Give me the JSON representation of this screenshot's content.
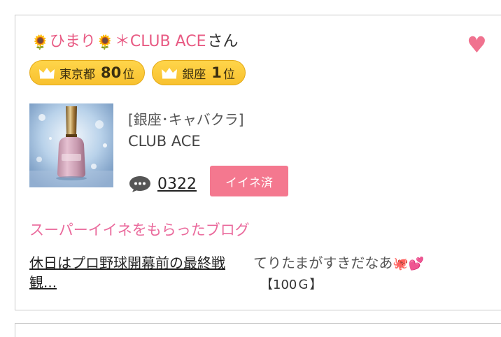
{
  "entry": {
    "name_icon_left": "🌻",
    "name_mid": "ひまり",
    "name_icon_mid": "🌻",
    "name_tail": "＊CLUB ACE",
    "honorific": "さん",
    "favorite_icon": "heart-icon",
    "badges": [
      {
        "area": "東京都",
        "rank": "80",
        "suffix": "位"
      },
      {
        "area": "銀座",
        "rank": "1",
        "suffix": "位"
      }
    ],
    "category": "[銀座･キャバクラ]",
    "shop": "CLUB ACE",
    "comment_count": "0322",
    "iine_label": "イイネ済"
  },
  "section_title": "スーパーイイネをもらったブログ",
  "blog": {
    "title": "休日はプロ野球開幕前の最終戦観...",
    "author": "てりたまがすきだなあ",
    "author_emoji": "🐙💕",
    "points": "【100Ｇ】"
  },
  "colors": {
    "accent_pink": "#f4788f",
    "badge_gold": "#f8c12f",
    "name_pink": "#e85a83"
  }
}
